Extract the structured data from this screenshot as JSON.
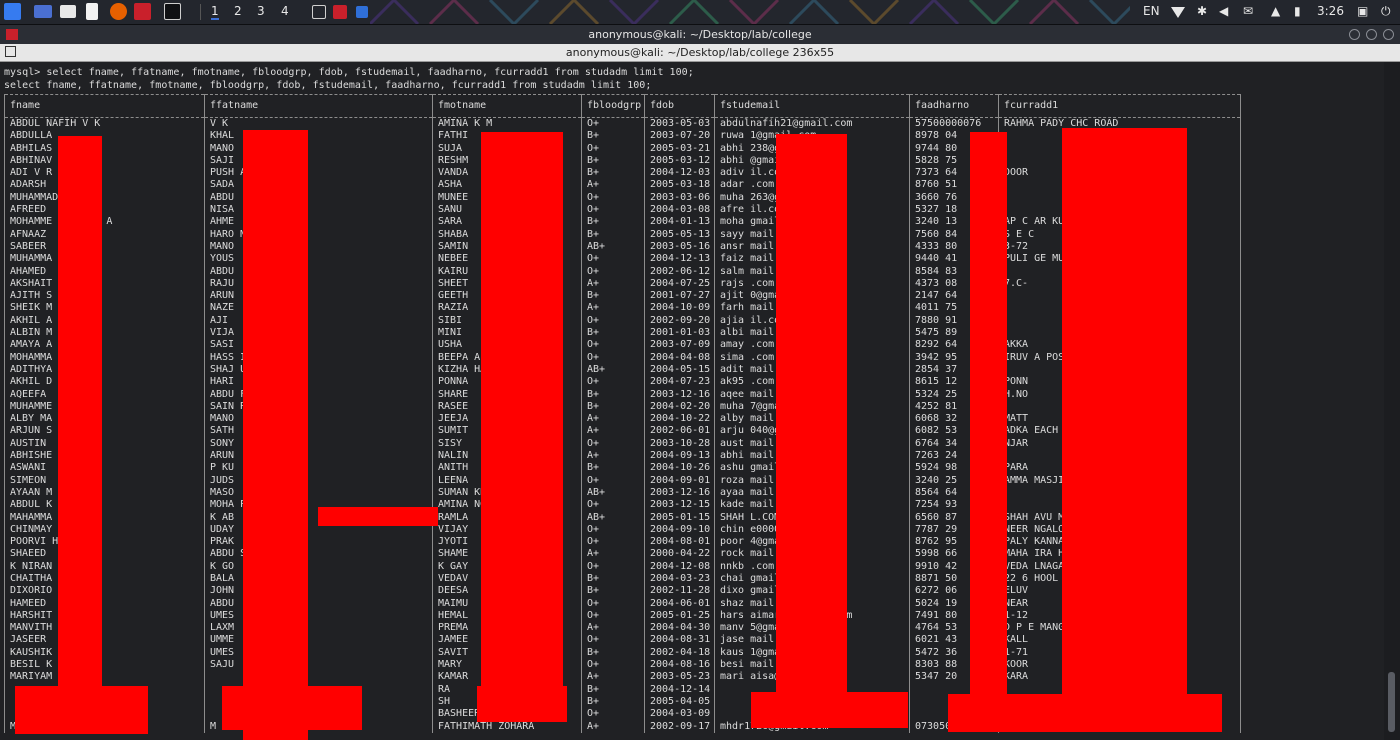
{
  "panel": {
    "workspaces": [
      "1",
      "2",
      "3",
      "4"
    ],
    "keyboard_layout": "EN",
    "clock": "3:26",
    "colors": {
      "panel_bg": "#23262d",
      "accent": "#3b6fd6"
    }
  },
  "window": {
    "title": "anonymous@kali: ~/Desktop/lab/college",
    "tab_title": "anonymous@kali: ~/Desktop/lab/college 236x55"
  },
  "terminal": {
    "command_line": "mysql> select fname, ffatname, fmotname, fbloodgrp, fdob, fstudemail, faadharno, fcurradd1 from studadm limit 100;",
    "echo_line": "select fname, ffatname, fmotname, fbloodgrp, fdob, fstudemail, faadharno, fcurradd1 from studadm limit 100;",
    "columns": [
      "fname",
      "ffatname",
      "fmotname",
      "fbloodgrp",
      "fdob",
      "fstudemail",
      "faadharno",
      "fcurradd1"
    ],
    "rows": [
      [
        "ABDUL NAFIH V K",
        "V K",
        "AMINA K M",
        "O+",
        "2003-05-03",
        "abdulnafih21@gmail.com",
        "57500000076",
        "RAHMA    PADY CHC ROAD"
      ],
      [
        "ABDULLA",
        "KHAL",
        "FATHI",
        "B+",
        "2003-07-20",
        "ruwa    1@gmail.com",
        "8978    04",
        ""
      ],
      [
        "ABHILAS",
        "MANO",
        "SUJA",
        "O+",
        "2005-03-21",
        "abhi    238@gmail.com",
        "9744    80",
        ""
      ],
      [
        "ABHINAV",
        "SAJI",
        "RESHM",
        "B+",
        "2005-03-12",
        "abhi    @gmail.com",
        "5828    75",
        ""
      ],
      [
        "ADI V R",
        "PUSH       ARA",
        "VANDA",
        "B+",
        "2004-12-03",
        "adiv    il.com",
        "7373    64",
        "DOOR"
      ],
      [
        "ADARSH",
        "SADA",
        "ASHA",
        "A+",
        "2005-03-18",
        "adar    .com",
        "8760    51",
        ""
      ],
      [
        "MUHAMMAD     MP",
        "ABDU",
        "MUNEE",
        "O+",
        "2003-03-06",
        "muha    263@gmail.com",
        "3660    76",
        ""
      ],
      [
        "AFREED",
        "NISA",
        "SANU",
        "O+",
        "2004-03-08",
        "afre    il.com",
        "5327    18",
        ""
      ],
      [
        "MOHAMME     AHEER P A",
        "AHME",
        "SARA",
        "B+",
        "2004-01-13",
        "moha    gmail.com",
        "3240    13",
        "AP C       AR KUMBADAJE"
      ],
      [
        "AFNAAZ",
        "HARO       M",
        "SHABA",
        "B+",
        "2005-05-13",
        "sayy    mail.com",
        "7560    84",
        "S E C"
      ],
      [
        "SABEER",
        "MANO",
        "SAMIN",
        "AB+",
        "2003-05-16",
        "ansr    mail.com",
        "4333    80",
        "3-72"
      ],
      [
        "MUHAMMA    L M K",
        "YOUS",
        "NEBEE",
        "O+",
        "2004-12-13",
        "faiz    mail.com",
        "9440    41",
        "PULI      GE MUDNOOR VILL"
      ],
      [
        "AHAMED",
        "ABDU",
        "KAIRU",
        "O+",
        "2002-06-12",
        "salm    mail.com",
        "8584    83",
        ""
      ],
      [
        "AKSHAIT",
        "RAJU",
        "SHEET",
        "A+",
        "2004-07-25",
        "rajs    .com",
        "4373    08",
        "7.C-"
      ],
      [
        "AJITH S",
        "ARUN",
        "GEETH",
        "B+",
        "2001-07-27",
        "ajit    0@gmail.com",
        "2147    64",
        ""
      ],
      [
        "SHEIK M     FARHAN",
        "NAZE",
        "RAZIA",
        "A+",
        "2004-10-09",
        "farh    mail",
        "4011    75",
        ""
      ],
      [
        "AKHIL A",
        "AJI",
        "SIBI",
        "O+",
        "2002-09-20",
        "ajia    il.com",
        "7880    91",
        ""
      ],
      [
        "ALBIN M",
        "VIJA",
        "MINI",
        "B+",
        "2001-01-03",
        "albi    mail.com",
        "5475    89",
        ""
      ],
      [
        "AMAYA A    GASI",
        "SASI",
        "USHA",
        "O+",
        "2003-07-09",
        "amay    .com",
        "8292    64",
        "AKKA"
      ],
      [
        "MOHAMMA    MAK",
        "HASS      I",
        "BEEPA       A",
        "O+",
        "2004-04-08",
        "sima    .com",
        "3942    95",
        "IRUV      A POST SULLIA"
      ],
      [
        "ADITHYA",
        "SHAJ       URAYIL",
        "KIZHA       HA",
        "AB+",
        "2004-05-15",
        "adit    mail.com",
        "2854    37",
        ""
      ],
      [
        "AKHIL D",
        "HARI",
        "PONNA",
        "O+",
        "2004-07-23",
        "ak95    .com",
        "8615    12",
        "PONN"
      ],
      [
        "AQEEFA",
        "ABDU      F",
        "SHARE",
        "B+",
        "2003-12-16",
        "aqee    mail.com",
        "5324    25",
        "H.NO"
      ],
      [
        "MUHAMME",
        "SAIN      RODI",
        "RASEE",
        "B+",
        "2004-02-20",
        "muha    7@gmail.com",
        "4252    81",
        ""
      ],
      [
        "ALBY MA",
        "MANO",
        "JEEJA",
        "A+",
        "2004-10-22",
        "alby    mail.com",
        "6068    32",
        "MATT"
      ],
      [
        "ARJUN S",
        "SATH",
        "SUMIT",
        "A+",
        "2002-06-01",
        "arju    040@gmail.com",
        "6082    53",
        "ADKA      EACH"
      ],
      [
        "AUSTIN",
        "SONY",
        "SISY",
        "O+",
        "2003-10-28",
        "aust    mail.com",
        "6764    34",
        "NJAR"
      ],
      [
        "ABHISHE",
        "ARUN",
        "NALIN",
        "A+",
        "2004-09-13",
        "abhi    mail.com",
        "7263    24",
        ""
      ],
      [
        "ASWANI",
        "P KU",
        "ANITH",
        "B+",
        "2004-10-26",
        "ashu    gmail.com",
        "5924    98",
        "PARA"
      ],
      [
        "SIMEON",
        "JUDS",
        "LEENA",
        "O+",
        "2004-09-01",
        "roza    mail.com",
        "3240    25",
        "AMMA      MASJID SIDDAPUR"
      ],
      [
        "AYAAN M    HAIKH",
        "MASO      ",
        "SUMAN       KH",
        "AB+",
        "2003-12-16",
        "ayaa    mail.com",
        "8564    64",
        ""
      ],
      [
        "ABDUL K    HRAF",
        "MOHA      P",
        "AMINA       NGARA",
        "O+",
        "2003-12-15",
        "kade    mail.com",
        "7254    93",
        ""
      ],
      [
        "MAHAMMA    M",
        "K AB",
        "RAMLA",
        "AB+",
        "2005-01-15",
        "SHAH    L.COM",
        "6560    87",
        "SHAH      AVU MADANOOR"
      ],
      [
        "CHINMAY",
        "UDAY",
        "VIJAY",
        "O+",
        "2004-09-10",
        "chin    e00007@gmail.com",
        "7787    29",
        "NEER      NGALORE ROAD"
      ],
      [
        "POORVI     HONAVAR",
        "PRAK",
        "JYOTI",
        "O+",
        "2004-08-01",
        "poor    4@gmail.com",
        "8762    95",
        "PALY      KANNADA"
      ],
      [
        "SHAEED",
        "ABDU       SSAIN",
        "SHAME",
        "A+",
        "2000-04-22",
        "rock    mail.com",
        "5998    66",
        "MAHA      IRA HOSPITAL"
      ],
      [
        "K NIRAN",
        "K GO",
        "K GAY",
        "O+",
        "2004-12-08",
        "nnkb    .com",
        "9910    42",
        "VEDA      LNAGARA IIND CR"
      ],
      [
        "CHAITHA    OOJARY",
        "BALA",
        "VEDAV",
        "B+",
        "2004-03-23",
        "chai    gmail.com",
        "8871    50",
        "22 6      HOOL"
      ],
      [
        "DIXORIO",
        "JOHN",
        "DEESA",
        "B+",
        "2002-11-28",
        "dixo    gmail.com",
        "6272    06",
        "ELUV"
      ],
      [
        "HAMEED",
        "ABDU",
        "MAIMU",
        "O+",
        "2004-06-01",
        "shaz    mail.com",
        "5024    19",
        "NEAR"
      ],
      [
        "HARSHIT",
        "UMES",
        "HEMAL",
        "O+",
        "2005-01-25",
        "hars    aimar25@gmail.com",
        "7491    80",
        "1-12"
      ],
      [
        "MANVITH     AN",
        "LAXM",
        "PREMA",
        "A+",
        "2004-04-30",
        "manv    5@gmail.com",
        "4764    53",
        "D P       E MANGALORE"
      ],
      [
        "JASEER",
        "UMME",
        "JAMEE",
        "O+",
        "2004-08-31",
        "jase    mail.com",
        "6021    43",
        "KALL"
      ],
      [
        "KAUSHIK",
        "UMES",
        "SAVIT",
        "B+",
        "2002-04-18",
        "kaus    1@gmail.com",
        "5472    36",
        "1-71"
      ],
      [
        "BESIL K",
        "SAJU",
        "MARY",
        "O+",
        "2004-08-16",
        "besi    mail.com",
        "8303    88",
        "KOOR"
      ],
      [
        "MARIYAM     MNAZIRA",
        "",
        "KAMAR",
        "A+",
        "2003-05-23",
        "mari    aisa@gmail.com",
        "5347    20",
        "KARA"
      ],
      [
        "",
        "",
        "RA",
        "B+",
        "2004-12-14",
        "",
        "",
        ""
      ],
      [
        "",
        "",
        "SH",
        "B+",
        "2005-04-05",
        "",
        "",
        ""
      ],
      [
        "",
        "",
        "BASHEERA B A",
        "O+",
        "2004-03-09",
        "",
        "",
        ""
      ],
      [
        "MAHAMMAD RAZIQ",
        "M K AHAMMAD YUSUF",
        "FATHIMATH ZOHARA",
        "A+",
        "2002-09-17",
        "mhdr1726@gmail.com",
        "073050042668",
        "BADRIYA MANZIL HOUSE"
      ]
    ]
  }
}
